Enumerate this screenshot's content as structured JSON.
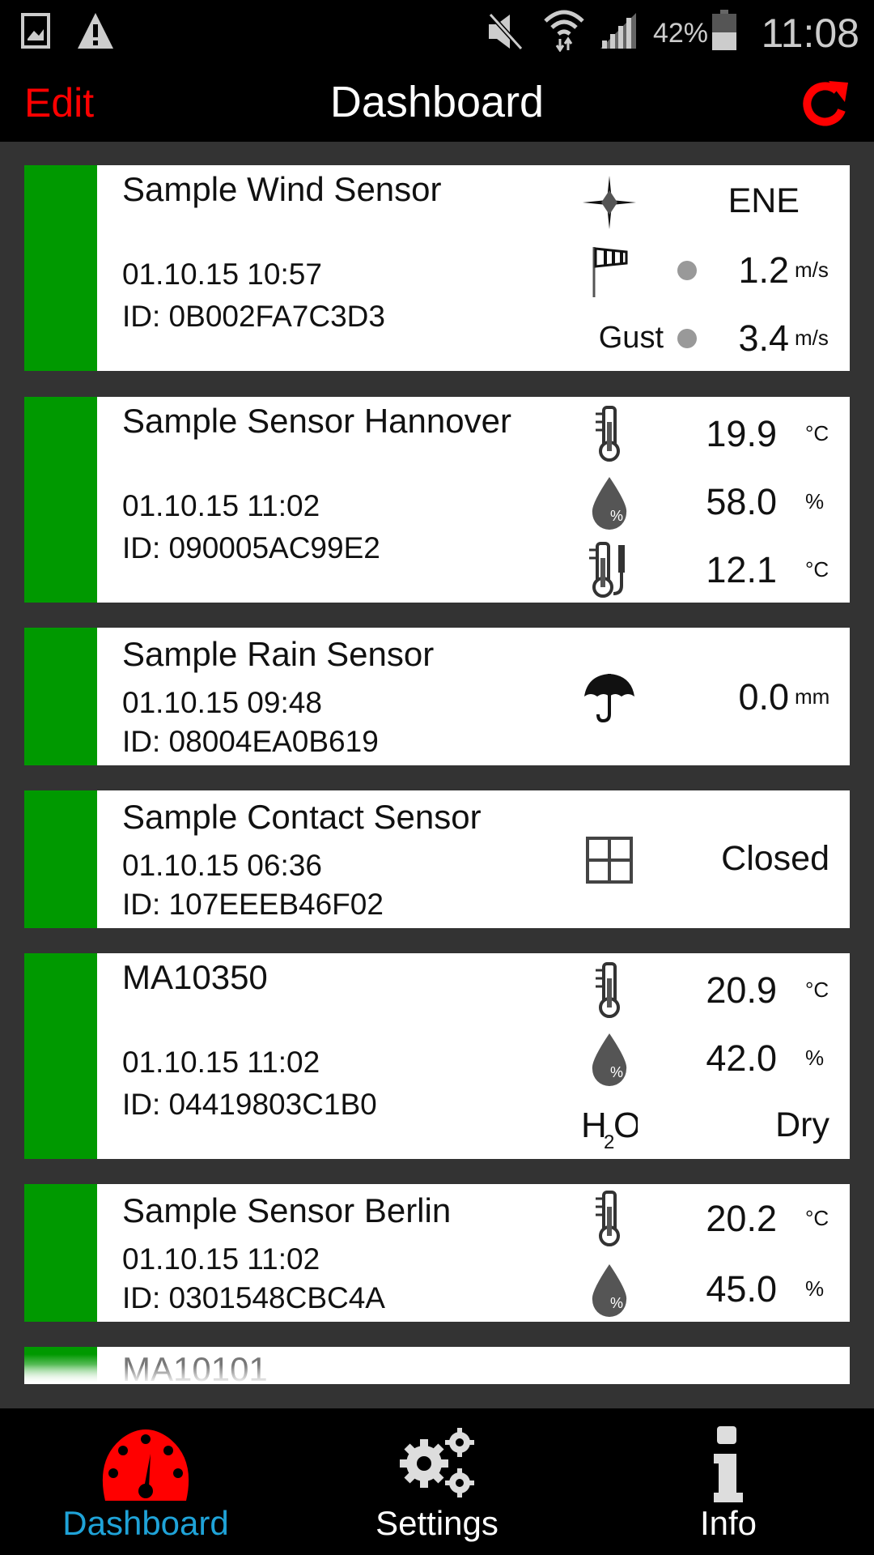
{
  "status_bar": {
    "battery": "42%",
    "time": "11:08",
    "battery_level": 0.42
  },
  "header": {
    "edit_label": "Edit",
    "title": "Dashboard",
    "refresh_icon": "refresh-icon",
    "accent": "#ff0000"
  },
  "sensors": [
    {
      "name": "Sample Wind Sensor",
      "date": "01.10.15  10:57",
      "id": "ID: 0B002FA7C3D3",
      "layout": "tall",
      "readings": [
        {
          "icon": "compass-icon",
          "value": "ENE",
          "unit": ""
        },
        {
          "icon": "windsock-icon",
          "value": "1.2",
          "unit": "m/s",
          "dot": true
        },
        {
          "icon": "",
          "label": "Gust",
          "value": "3.4",
          "unit": "m/s",
          "dot": true
        }
      ]
    },
    {
      "name": "Sample Sensor Hannover",
      "date": "01.10.15  11:02",
      "id": "ID: 090005AC99E2",
      "layout": "tall",
      "readings": [
        {
          "icon": "thermometer-icon",
          "value": "19.9",
          "unit": "°C"
        },
        {
          "icon": "humidity-drop-icon",
          "value": "58.0",
          "unit": "%"
        },
        {
          "icon": "probe-thermometer-icon",
          "value": "12.1",
          "unit": "°C"
        }
      ]
    },
    {
      "name": "Sample Rain Sensor",
      "date": "01.10.15  09:48",
      "id": "ID: 08004EA0B619",
      "layout": "short",
      "readings": [
        {
          "icon": "umbrella-icon",
          "value": "0.0",
          "unit": "mm"
        }
      ]
    },
    {
      "name": "Sample Contact Sensor",
      "date": "01.10.15  06:36",
      "id": "ID: 107EEEB46F02",
      "layout": "short",
      "readings": [
        {
          "icon": "window-icon",
          "value": "Closed",
          "unit": ""
        }
      ]
    },
    {
      "name": "MA10350",
      "date": "01.10.15  11:02",
      "id": "ID: 04419803C1B0",
      "layout": "tall",
      "readings": [
        {
          "icon": "thermometer-icon",
          "value": "20.9",
          "unit": "°C"
        },
        {
          "icon": "humidity-drop-icon",
          "value": "42.0",
          "unit": "%"
        },
        {
          "icon": "water-h2o-icon",
          "value": "Dry",
          "unit": ""
        }
      ]
    },
    {
      "name": "Sample Sensor Berlin",
      "date": "01.10.15  11:02",
      "id": "ID: 0301548CBC4A",
      "layout": "short",
      "readings": [
        {
          "icon": "thermometer-icon",
          "value": "20.2",
          "unit": "°C"
        },
        {
          "icon": "humidity-drop-icon",
          "value": "45.0",
          "unit": "%"
        }
      ]
    },
    {
      "name": "MA10101",
      "layout": "partial",
      "readings": []
    }
  ],
  "status_color": "#009900",
  "nav": {
    "tabs": [
      {
        "label": "Dashboard",
        "icon": "dashboard-gauge-icon",
        "active": true
      },
      {
        "label": "Settings",
        "icon": "gears-icon",
        "active": false
      },
      {
        "label": "Info",
        "icon": "info-icon",
        "active": false
      }
    ],
    "active_color": "#1fa3d8"
  }
}
